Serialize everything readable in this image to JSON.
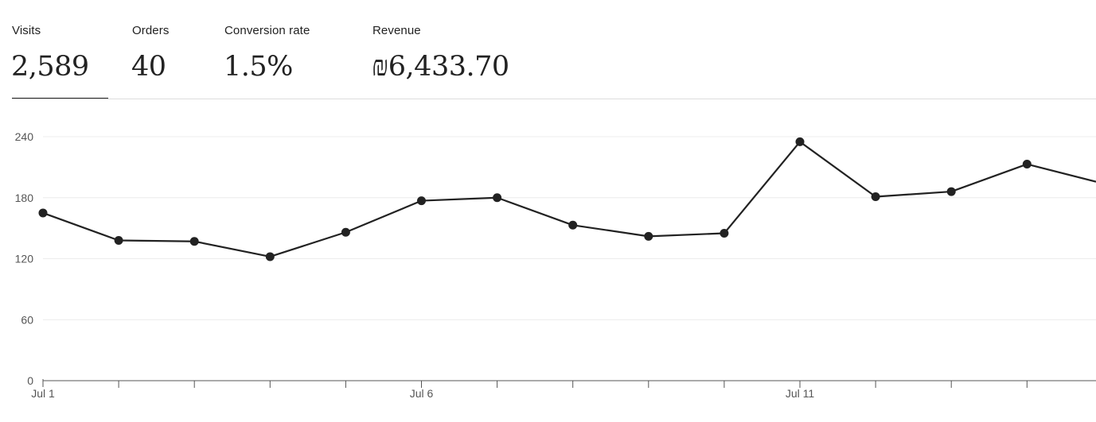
{
  "stats": [
    {
      "label": "Visits",
      "value": "2,589",
      "active": true
    },
    {
      "label": "Orders",
      "value": "40",
      "active": false
    },
    {
      "label": "Conversion rate",
      "value": "1.5%",
      "active": false
    },
    {
      "label": "Revenue",
      "value": "₪6,433.70",
      "active": false
    }
  ],
  "colors": {
    "series": "#222222",
    "axis": "#555555",
    "grid": "#ececec",
    "divider": "#dddddd"
  },
  "chart_data": {
    "type": "line",
    "title": "",
    "xlabel": "",
    "ylabel": "",
    "x": [
      "Jul 1",
      "Jul 2",
      "Jul 3",
      "Jul 4",
      "Jul 5",
      "Jul 6",
      "Jul 7",
      "Jul 8",
      "Jul 9",
      "Jul 10",
      "Jul 11",
      "Jul 12",
      "Jul 13",
      "Jul 14",
      "Jul 15"
    ],
    "x_tick_labels": [
      "Jul 1",
      "Jul 6",
      "Jul 11"
    ],
    "series": [
      {
        "name": "",
        "values": [
          165,
          138,
          137,
          122,
          146,
          177,
          180,
          153,
          142,
          145,
          235,
          181,
          186,
          213,
          194
        ]
      }
    ],
    "ylim": [
      0,
      240
    ],
    "yticks": [
      0,
      60,
      120,
      180,
      240
    ],
    "grid": true,
    "legend": "none"
  }
}
